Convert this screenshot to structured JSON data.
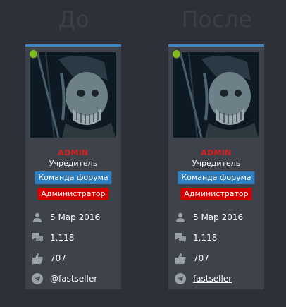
{
  "columns": {
    "before": {
      "title": "До",
      "user": {
        "name": "ADMIN",
        "title": "Учредитель",
        "badges": [
          "Команда форума",
          "Администратор"
        ],
        "joined": "5 Мар 2016",
        "messages": "1,118",
        "reactions": "707",
        "telegram": "@fastseller"
      }
    },
    "after": {
      "title": "После",
      "user": {
        "name": "ADMIN",
        "title": "Учредитель",
        "badges": [
          "Команда форума",
          "Администратор"
        ],
        "joined": "5 Мар 2016",
        "messages": "1,118",
        "reactions": "707",
        "telegram": "fastseller"
      }
    }
  },
  "icons": {
    "joined": "user-icon",
    "messages": "chat-bubbles-icon",
    "reactions": "thumbs-up-icon",
    "telegram": "telegram-icon"
  },
  "colors": {
    "background": "#2d3038",
    "card": "#3e424b",
    "accent": "#3d87c4",
    "username": "#d71f1f",
    "badge_team": "#2d7fc1",
    "badge_admin": "#d50000",
    "online": "#7fbb1c"
  }
}
